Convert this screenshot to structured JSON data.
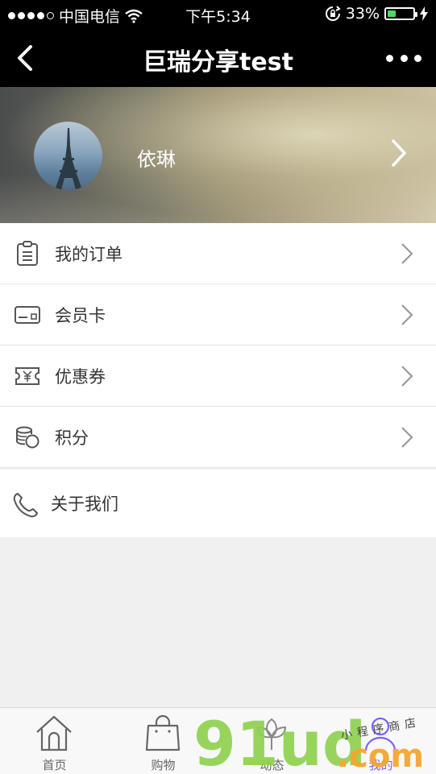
{
  "status_bar": {
    "carrier": "中国电信",
    "time": "下午5:34",
    "battery_percent": "33%",
    "battery_level": 0.33,
    "signal_bars_filled": 4,
    "signal_bars_total": 5
  },
  "nav": {
    "title": "巨瑞分享test",
    "back_icon": "chevron-left-icon",
    "more_icon": "more-dots-icon"
  },
  "profile": {
    "username": "依琳",
    "avatar_icon": "eiffel-tower-avatar"
  },
  "menu": {
    "items": [
      {
        "label": "我的订单",
        "icon": "order-list-icon"
      },
      {
        "label": "会员卡",
        "icon": "member-card-icon"
      },
      {
        "label": "优惠券",
        "icon": "coupon-icon"
      },
      {
        "label": "积分",
        "icon": "points-icon"
      }
    ],
    "about": {
      "label": "关于我们",
      "icon": "phone-icon"
    }
  },
  "tabbar": {
    "tabs": [
      {
        "label": "首页",
        "icon": "home-icon"
      },
      {
        "label": "购物",
        "icon": "shopping-bag-icon"
      },
      {
        "label": "动态",
        "icon": "leaf-icon"
      },
      {
        "label": "我的",
        "icon": "user-icon",
        "active": true
      }
    ]
  },
  "watermark": {
    "logo": "91ud",
    "suffix": ".com",
    "tagline": "小程序商店"
  },
  "colors": {
    "header_bg": "#000000",
    "battery_fill": "#4cd964",
    "active_tab": "#7b61ff",
    "watermark_green": "#8fd14f",
    "watermark_orange": "#f7a531",
    "page_bg": "#f0f0f0"
  }
}
